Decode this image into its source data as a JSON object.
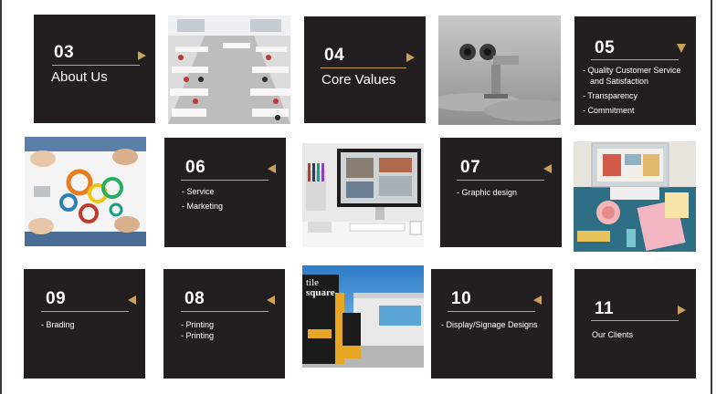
{
  "tiles": {
    "about": {
      "number": "03",
      "title": "About Us"
    },
    "core": {
      "number": "04",
      "title": "Core Values"
    },
    "values": {
      "number": "05",
      "items": [
        "- Quality Customer Service",
        "and Satisfaction",
        "- Transparency",
        "- Commitment"
      ]
    },
    "marketing": {
      "number": "06",
      "items": [
        "- Service",
        "- Marketing"
      ]
    },
    "graphic": {
      "number": "07",
      "items": [
        "- Graphic design"
      ]
    },
    "brading": {
      "number": "09",
      "items": [
        "- Brading"
      ]
    },
    "printing": {
      "number": "08",
      "items": [
        "- Printing",
        "- Printing"
      ]
    },
    "display": {
      "number": "10",
      "items": [
        "- Display/Signage Designs"
      ]
    },
    "clients": {
      "number": "11",
      "title": "Our Clients"
    }
  },
  "signage": {
    "line1": "tile",
    "line2": "square"
  },
  "colors": {
    "tile": "#231f20",
    "accent": "#c9a15b"
  }
}
